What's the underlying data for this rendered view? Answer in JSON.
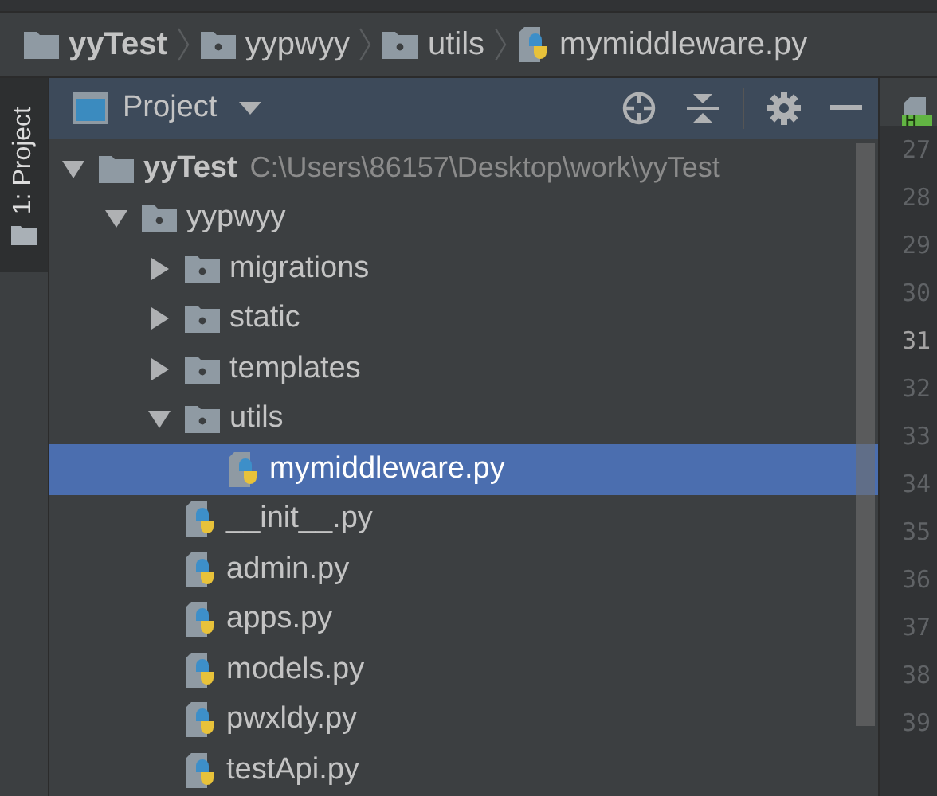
{
  "breadcrumbs": [
    {
      "label": "yyTest",
      "kind": "root"
    },
    {
      "label": "yypwyy",
      "kind": "package"
    },
    {
      "label": "utils",
      "kind": "package"
    },
    {
      "label": "mymiddleware.py",
      "kind": "file"
    }
  ],
  "tool_window_tabs": [
    {
      "label": "1: Project",
      "selected": true
    }
  ],
  "panel": {
    "title": "Project"
  },
  "editor_tab": {
    "badge": "H"
  },
  "tree": [
    {
      "label": "yyTest",
      "kind": "root",
      "path": "C:\\Users\\86157\\Desktop\\work\\yyTest",
      "expanded": true,
      "selected": false,
      "children": [
        {
          "label": "yypwyy",
          "kind": "package",
          "expanded": true,
          "selected": false,
          "children": [
            {
              "label": "migrations",
              "kind": "package",
              "expanded": false,
              "selected": false
            },
            {
              "label": "static",
              "kind": "package",
              "expanded": false,
              "selected": false
            },
            {
              "label": "templates",
              "kind": "package",
              "expanded": false,
              "selected": false
            },
            {
              "label": "utils",
              "kind": "package",
              "expanded": true,
              "selected": false,
              "children": [
                {
                  "label": "mymiddleware.py",
                  "kind": "file",
                  "selected": true
                }
              ]
            },
            {
              "label": "__init__.py",
              "kind": "file",
              "selected": false
            },
            {
              "label": "admin.py",
              "kind": "file",
              "selected": false
            },
            {
              "label": "apps.py",
              "kind": "file",
              "selected": false
            },
            {
              "label": "models.py",
              "kind": "file",
              "selected": false
            },
            {
              "label": "pwxldy.py",
              "kind": "file",
              "selected": false
            },
            {
              "label": "testApi.py",
              "kind": "file",
              "selected": false
            }
          ]
        }
      ]
    }
  ],
  "line_numbers": [
    {
      "label": "27",
      "current": false
    },
    {
      "label": "28",
      "current": false
    },
    {
      "label": "29",
      "current": false
    },
    {
      "label": "30",
      "current": false
    },
    {
      "label": "31",
      "current": true
    },
    {
      "label": "32",
      "current": false
    },
    {
      "label": "33",
      "current": false
    },
    {
      "label": "34",
      "current": false
    },
    {
      "label": "35",
      "current": false
    },
    {
      "label": "36",
      "current": false
    },
    {
      "label": "37",
      "current": false
    },
    {
      "label": "38",
      "current": false
    },
    {
      "label": "39",
      "current": false
    }
  ]
}
